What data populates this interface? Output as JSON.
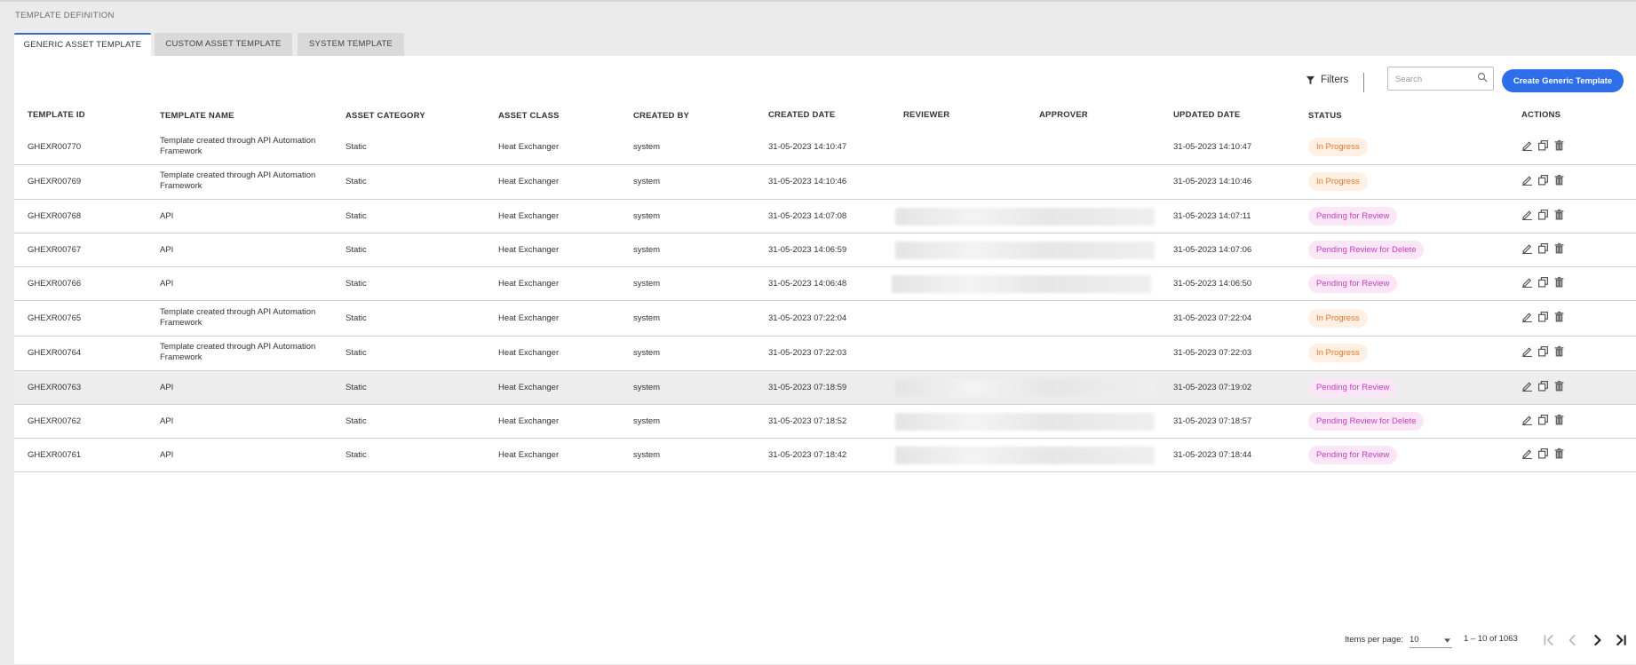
{
  "page": {
    "title": "TEMPLATE DEFINITION"
  },
  "tabs": [
    {
      "label": "GENERIC ASSET TEMPLATE",
      "active": true
    },
    {
      "label": "CUSTOM ASSET TEMPLATE",
      "active": false
    },
    {
      "label": "SYSTEM TEMPLATE",
      "active": false
    }
  ],
  "toolbar": {
    "filters_label": "Filters",
    "filter_icon": "filter-icon",
    "search_placeholder": "Search",
    "search_icon": "search-icon",
    "create_label": "Create Generic Template",
    "create_color": "#2e6ee8"
  },
  "table": {
    "headers": {
      "id": "TEMPLATE ID",
      "name": "TEMPLATE NAME",
      "category": "ASSET CATEGORY",
      "class": "ASSET CLASS",
      "created_by": "CREATED BY",
      "created_date": "CREATED DATE",
      "reviewer": "REVIEWER",
      "approver": "APPROVER",
      "updated_date": "UPDATED DATE",
      "status": "STATUS",
      "actions": "ACTIONS"
    },
    "rows": [
      {
        "id": "GHEXR00770",
        "name": "Template created through API Automation Framework",
        "category": "Static",
        "class": "Heat Exchanger",
        "created_by": "system",
        "created_date": "31-05-2023 14:10:47",
        "reviewer_redacted": false,
        "updated_date": "31-05-2023 14:10:47",
        "status": "In Progress",
        "status_type": "progress"
      },
      {
        "id": "GHEXR00769",
        "name": "Template created through API Automation Framework",
        "category": "Static",
        "class": "Heat Exchanger",
        "created_by": "system",
        "created_date": "31-05-2023 14:10:46",
        "reviewer_redacted": false,
        "updated_date": "31-05-2023 14:10:46",
        "status": "In Progress",
        "status_type": "progress"
      },
      {
        "id": "GHEXR00768",
        "name": "API",
        "category": "Static",
        "class": "Heat Exchanger",
        "created_by": "system",
        "created_date": "31-05-2023 14:07:08",
        "reviewer_redacted": true,
        "updated_date": "31-05-2023 14:07:11",
        "status": "Pending for Review",
        "status_type": "pending"
      },
      {
        "id": "GHEXR00767",
        "name": "API",
        "category": "Static",
        "class": "Heat Exchanger",
        "created_by": "system",
        "created_date": "31-05-2023 14:06:59",
        "reviewer_redacted": true,
        "updated_date": "31-05-2023 14:07:06",
        "status": "Pending Review for Delete",
        "status_type": "pending"
      },
      {
        "id": "GHEXR00766",
        "name": "API",
        "category": "Static",
        "class": "Heat Exchanger",
        "created_by": "system",
        "created_date": "31-05-2023 14:06:48",
        "reviewer_redacted": true,
        "updated_date": "31-05-2023 14:06:50",
        "status": "Pending for Review",
        "status_type": "pending"
      },
      {
        "id": "GHEXR00765",
        "name": "Template created through API Automation Framework",
        "category": "Static",
        "class": "Heat Exchanger",
        "created_by": "system",
        "created_date": "31-05-2023 07:22:04",
        "reviewer_redacted": false,
        "updated_date": "31-05-2023 07:22:04",
        "status": "In Progress",
        "status_type": "progress"
      },
      {
        "id": "GHEXR00764",
        "name": "Template created through API Automation Framework",
        "category": "Static",
        "class": "Heat Exchanger",
        "created_by": "system",
        "created_date": "31-05-2023 07:22:03",
        "reviewer_redacted": false,
        "updated_date": "31-05-2023 07:22:03",
        "status": "In Progress",
        "status_type": "progress"
      },
      {
        "id": "GHEXR00763",
        "name": "API",
        "category": "Static",
        "class": "Heat Exchanger",
        "created_by": "system",
        "created_date": "31-05-2023 07:18:59",
        "reviewer_redacted": true,
        "updated_date": "31-05-2023 07:19:02",
        "status": "Pending for Review",
        "status_type": "pending",
        "highlighted": true
      },
      {
        "id": "GHEXR00762",
        "name": "API",
        "category": "Static",
        "class": "Heat Exchanger",
        "created_by": "system",
        "created_date": "31-05-2023 07:18:52",
        "reviewer_redacted": true,
        "updated_date": "31-05-2023 07:18:57",
        "status": "Pending Review for Delete",
        "status_type": "pending"
      },
      {
        "id": "GHEXR00761",
        "name": "API",
        "category": "Static",
        "class": "Heat Exchanger",
        "created_by": "system",
        "created_date": "31-05-2023 07:18:42",
        "reviewer_redacted": true,
        "updated_date": "31-05-2023 07:18:44",
        "status": "Pending for Review",
        "status_type": "pending"
      }
    ],
    "row_action_icons": [
      "edit-icon",
      "copy-icon",
      "delete-icon"
    ]
  },
  "status_colors": {
    "progress_bg": "#fff0e3",
    "progress_fg": "#e0782a",
    "pending_bg": "#fbe6f7",
    "pending_fg": "#c23fbf"
  },
  "pagination": {
    "items_per_page_label": "Items per page:",
    "items_per_page_value": "10",
    "range_label": "1 – 10 of 1063"
  }
}
